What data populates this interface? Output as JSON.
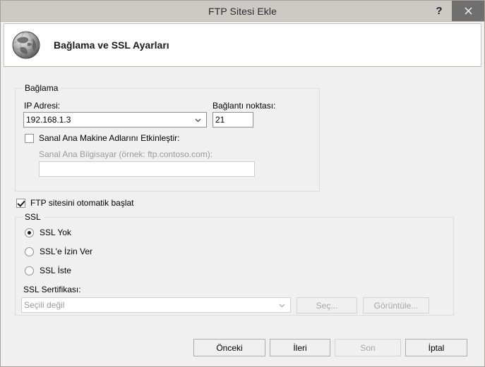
{
  "window": {
    "title": "FTP Sitesi Ekle",
    "help_label": "?",
    "close_label": "✕"
  },
  "header": {
    "title": "Bağlama ve SSL Ayarları",
    "icon": "globe-icon"
  },
  "binding_group": {
    "legend": "Bağlama",
    "ip_label": "IP Adresi:",
    "ip_value": "192.168.1.3",
    "port_label": "Bağlantı noktası:",
    "port_value": "21",
    "virtual_host_checkbox_label": "Sanal Ana Makine Adlarını Etkinleştir:",
    "virtual_host_checked": false,
    "virtual_host_hint": "Sanal Ana Bilgisayar (örnek: ftp.contoso.com):",
    "virtual_host_value": ""
  },
  "autostart": {
    "label": "FTP sitesini otomatik başlat",
    "checked": true
  },
  "ssl_group": {
    "legend": "SSL",
    "options": [
      {
        "label": "SSL Yok",
        "selected": true
      },
      {
        "label": "SSL'e İzin Ver",
        "selected": false
      },
      {
        "label": "SSL İste",
        "selected": false
      }
    ],
    "certificate_label": "SSL Sertifikası:",
    "certificate_value": "Seçili değil",
    "select_button": "Seç...",
    "view_button": "Görüntüle..."
  },
  "footer": {
    "previous": "Önceki",
    "next": "İleri",
    "finish": "Son",
    "cancel": "İptal"
  },
  "colors": {
    "titlebar": "#cdc9c5",
    "close_button": "#6f6f6f",
    "dialog_bg": "#f0f0f0",
    "field_border": "#8e8f8f",
    "disabled_text": "#9a9a9a"
  }
}
